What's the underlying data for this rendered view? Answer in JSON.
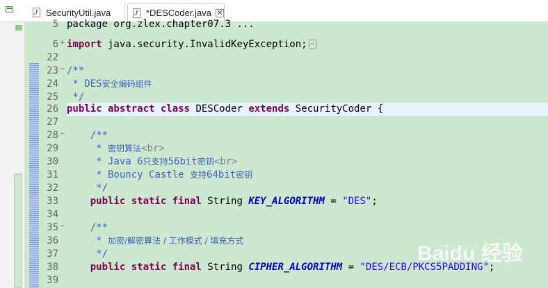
{
  "tabs": [
    {
      "label": "SecurityUtil.java",
      "active": false
    },
    {
      "label": "*DESCoder.java",
      "active": true
    }
  ],
  "editor": {
    "lines": [
      {
        "num": "5",
        "segments": [
          {
            "c": "plain",
            "t": "package org.zlex.chapter07.3 ..."
          }
        ]
      },
      {
        "num": "6",
        "fold": "+",
        "segments": [
          {
            "c": "kw",
            "t": "import"
          },
          {
            "c": "plain",
            "t": " java.security.InvalidKeyException;"
          }
        ],
        "ellipsis": true
      },
      {
        "num": "22",
        "segments": []
      },
      {
        "num": "23",
        "fold": "−",
        "segments": [
          {
            "c": "cmt",
            "t": "/**"
          }
        ]
      },
      {
        "num": "24",
        "segments": [
          {
            "c": "cmt",
            "t": " * DES"
          },
          {
            "c": "cmt cn",
            "t": "安全编码组件"
          }
        ]
      },
      {
        "num": "25",
        "segments": [
          {
            "c": "cmt",
            "t": " */"
          }
        ]
      },
      {
        "num": "26",
        "segments": [
          {
            "c": "kw",
            "t": "public abstract class"
          },
          {
            "c": "plain",
            "t": " DESCoder "
          },
          {
            "c": "kw",
            "t": "extends"
          },
          {
            "c": "plain",
            "t": " SecurityCoder {"
          }
        ]
      },
      {
        "num": "27",
        "segments": []
      },
      {
        "num": "28",
        "fold": "−",
        "segments": [
          {
            "c": "cmt",
            "t": "    /**"
          }
        ]
      },
      {
        "num": "29",
        "segments": [
          {
            "c": "cmt",
            "t": "     * "
          },
          {
            "c": "cmt cn",
            "t": "密钥算法"
          },
          {
            "c": "tag",
            "t": "<br>"
          }
        ]
      },
      {
        "num": "30",
        "segments": [
          {
            "c": "cmt",
            "t": "     * Java 6"
          },
          {
            "c": "cmt cn",
            "t": "只支持"
          },
          {
            "c": "cmt",
            "t": "56bit"
          },
          {
            "c": "cmt cn",
            "t": "密钥"
          },
          {
            "c": "tag",
            "t": "<br>"
          }
        ]
      },
      {
        "num": "31",
        "segments": [
          {
            "c": "cmt",
            "t": "     * Bouncy Castle "
          },
          {
            "c": "cmt cn",
            "t": "支持"
          },
          {
            "c": "cmt",
            "t": "64bit"
          },
          {
            "c": "cmt cn",
            "t": "密钥"
          }
        ]
      },
      {
        "num": "32",
        "segments": [
          {
            "c": "cmt",
            "t": "     */"
          }
        ]
      },
      {
        "num": "33",
        "segments": [
          {
            "c": "kw",
            "t": "    public static final"
          },
          {
            "c": "plain",
            "t": " String "
          },
          {
            "c": "const",
            "t": "KEY_ALGORITHM"
          },
          {
            "c": "plain",
            "t": " = "
          },
          {
            "c": "str",
            "t": "\"DES\""
          },
          {
            "c": "plain",
            "t": ";"
          }
        ]
      },
      {
        "num": "34",
        "segments": []
      },
      {
        "num": "35",
        "fold": "−",
        "segments": [
          {
            "c": "cmt",
            "t": "    /**"
          }
        ]
      },
      {
        "num": "36",
        "segments": [
          {
            "c": "cmt",
            "t": "     * "
          },
          {
            "c": "cmt cn",
            "t": "加密/解密算法 / 工作模式 / 填充方式"
          }
        ]
      },
      {
        "num": "37",
        "segments": [
          {
            "c": "cmt",
            "t": "     */"
          }
        ]
      },
      {
        "num": "38",
        "segments": [
          {
            "c": "kw",
            "t": "    public static final"
          },
          {
            "c": "plain",
            "t": " String "
          },
          {
            "c": "const",
            "t": "CIPHER_ALGORITHM"
          },
          {
            "c": "plain",
            "t": " = "
          },
          {
            "c": "str",
            "t": "\"DES/ECB/PKCS5PADDING\""
          },
          {
            "c": "plain",
            "t": ";"
          }
        ]
      },
      {
        "num": "39",
        "segments": []
      }
    ]
  },
  "watermark": "Baidu 经验",
  "colors": {
    "background": "#cce8cf",
    "keyword": "#7f0055",
    "comment": "#3f5fbf",
    "string": "#2a00ff",
    "constant": "#0000c0",
    "current_line": "#e8f2fe"
  }
}
